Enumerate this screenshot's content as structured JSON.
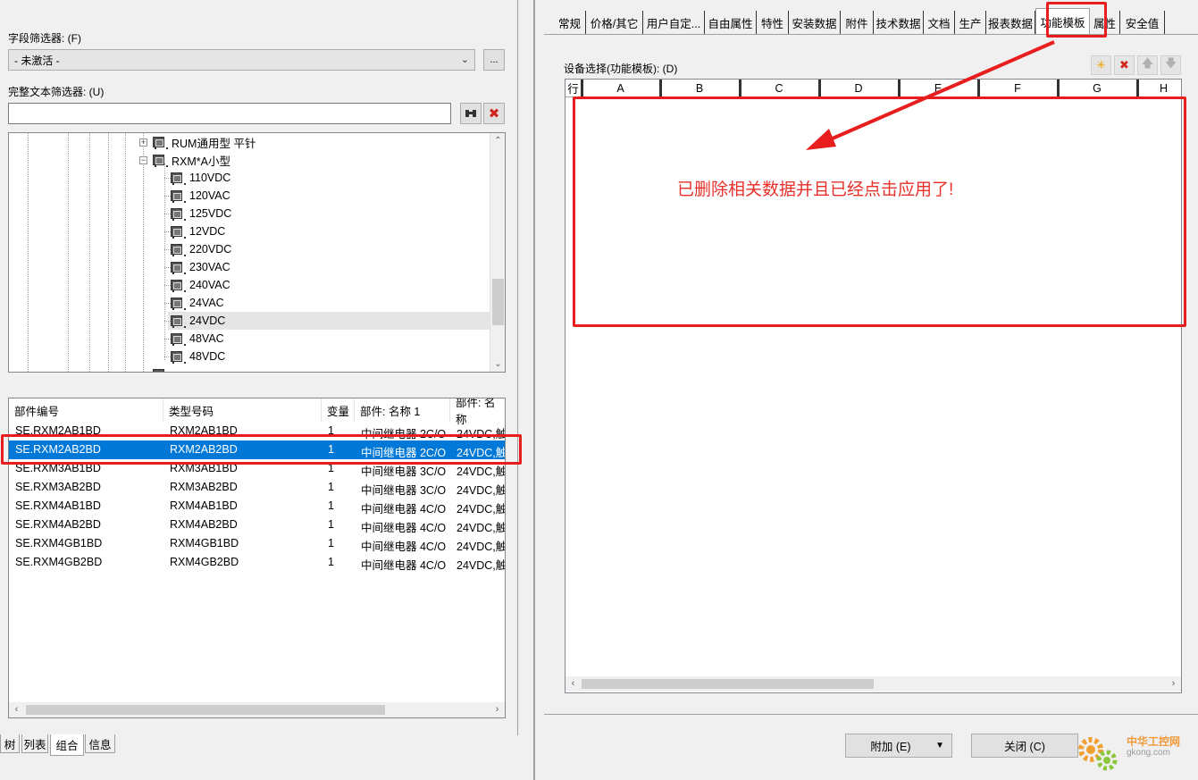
{
  "left": {
    "field_filter_label": "字段筛选器: (F)",
    "field_filter_value": "- 未激活 -",
    "field_filter_more": "...",
    "fulltext_label": "完整文本筛选器: (U)",
    "fulltext_value": "",
    "tree": {
      "items": [
        {
          "label": "RUM通用型 平针",
          "level": 0,
          "expander": "+"
        },
        {
          "label": "RXM*A小型",
          "level": 0,
          "expander": "-"
        },
        {
          "label": "110VDC",
          "level": 1
        },
        {
          "label": "120VAC",
          "level": 1
        },
        {
          "label": "125VDC",
          "level": 1
        },
        {
          "label": "12VDC",
          "level": 1
        },
        {
          "label": "220VDC",
          "level": 1
        },
        {
          "label": "230VAC",
          "level": 1
        },
        {
          "label": "240VAC",
          "level": 1
        },
        {
          "label": "24VAC",
          "level": 1
        },
        {
          "label": "24VDC",
          "level": 1,
          "selected": true
        },
        {
          "label": "48VAC",
          "level": 1
        },
        {
          "label": "48VDC",
          "level": 1
        }
      ]
    },
    "table": {
      "columns": [
        "部件编号",
        "类型号码",
        "变量",
        "部件: 名称 1",
        "部件: 名称"
      ],
      "rows": [
        [
          "SE.RXM2AB1BD",
          "RXM2AB1BD",
          "1",
          "中间继电器 2C/O",
          "24VDC,触"
        ],
        [
          "SE.RXM2AB2BD",
          "RXM2AB2BD",
          "1",
          "中间继电器 2C/O",
          "24VDC,触"
        ],
        [
          "SE.RXM3AB1BD",
          "RXM3AB1BD",
          "1",
          "中间继电器 3C/O",
          "24VDC,触"
        ],
        [
          "SE.RXM3AB2BD",
          "RXM3AB2BD",
          "1",
          "中间继电器 3C/O",
          "24VDC,触"
        ],
        [
          "SE.RXM4AB1BD",
          "RXM4AB1BD",
          "1",
          "中间继电器 4C/O",
          "24VDC,触"
        ],
        [
          "SE.RXM4AB2BD",
          "RXM4AB2BD",
          "1",
          "中间继电器 4C/O",
          "24VDC,触"
        ],
        [
          "SE.RXM4GB1BD",
          "RXM4GB1BD",
          "1",
          "中间继电器 4C/O",
          "24VDC,触"
        ],
        [
          "SE.RXM4GB2BD",
          "RXM4GB2BD",
          "1",
          "中间继电器 4C/O",
          "24VDC,触"
        ]
      ],
      "selected_row": 1
    },
    "bottom_tabs": [
      "树",
      "列表",
      "组合",
      "信息"
    ],
    "active_bottom_tab": "组合"
  },
  "right": {
    "tabs": [
      "常规",
      "价格/其它",
      "用户自定...",
      "自由属性",
      "特性",
      "安装数据",
      "附件",
      "技术数据",
      "文档",
      "生产",
      "报表数据",
      "功能模板",
      "属性",
      "安全值"
    ],
    "active_tab": "功能模板",
    "device_selection_label": "设备选择(功能模板): (D)",
    "grid_columns": [
      "行",
      "A",
      "B",
      "C",
      "D",
      "E",
      "F",
      "G",
      "H"
    ],
    "annotation_text": "已删除相关数据并且已经点击应用了!",
    "attach_button": "附加 (E)",
    "close_button": "关闭 (C)"
  },
  "watermark": {
    "line1": "中华工控网",
    "line2": "gkong.com"
  },
  "colors": {
    "selection": "#0078d7",
    "annotation_red": "#e81e1e"
  }
}
